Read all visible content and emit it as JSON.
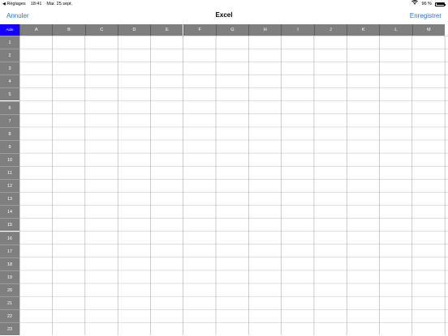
{
  "status_bar": {
    "back_label": "Réglages",
    "time": "18:41",
    "date": "Mar. 25 sept.",
    "battery": "96 %"
  },
  "nav": {
    "cancel_label": "Annuler",
    "title": "Excel",
    "save_label": "Enregistrer"
  },
  "grid": {
    "corner_label": "Aide",
    "columns": [
      "A",
      "B",
      "C",
      "D",
      "E",
      "F",
      "G",
      "H",
      "I",
      "J",
      "K",
      "L",
      "M"
    ],
    "rows": [
      "1",
      "2",
      "3",
      "4",
      "5",
      "6",
      "7",
      "8",
      "9",
      "10",
      "11",
      "12",
      "13",
      "14",
      "15",
      "16",
      "17",
      "18",
      "19",
      "20",
      "21",
      "22",
      "23"
    ]
  },
  "colors": {
    "accent": "#1a73e8",
    "corner_button": "#1400ff",
    "header_gray": "#7f7f7f"
  }
}
